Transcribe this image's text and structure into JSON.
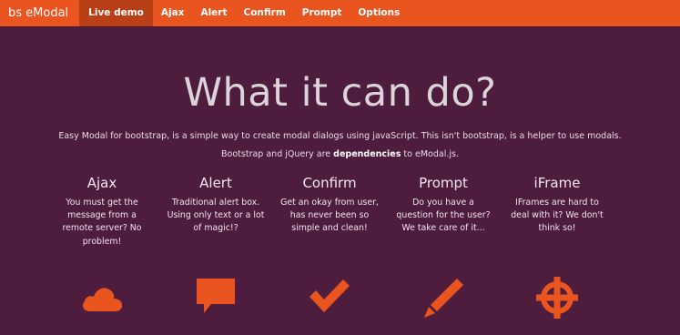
{
  "nav": {
    "brand": "bs eModal",
    "items": [
      "Live demo",
      "Ajax",
      "Alert",
      "Confirm",
      "Prompt",
      "Options"
    ]
  },
  "hero": {
    "title": "What it can do?",
    "lead1": "Easy Modal for bootstrap, is a simple way to create modal dialogs using javaScript. This isn't bootstrap, is a helper to use modals.",
    "lead2_prefix": "Bootstrap and jQuery are ",
    "lead2_bold": "dependencies",
    "lead2_suffix": " to eModal.js."
  },
  "features": [
    {
      "title": "Ajax",
      "desc": "You must get the message from a remote server? No problem!",
      "icon": "cloud-icon"
    },
    {
      "title": "Alert",
      "desc": "Traditional alert box. Using only text or a lot of magic!?",
      "icon": "speech-bubble-icon"
    },
    {
      "title": "Confirm",
      "desc": "Get an okay from user, has never been so simple and clean!",
      "icon": "checkmark-icon"
    },
    {
      "title": "Prompt",
      "desc": "Do you have a question for the user? We take care of it...",
      "icon": "pencil-icon"
    },
    {
      "title": "iFrame",
      "desc": "IFrames are hard to deal with it? We don't think so!",
      "icon": "crosshair-icon"
    }
  ],
  "colors": {
    "navbar": "#e9541f",
    "navbar_active": "#b93f17",
    "background": "#4e1c3d",
    "icon": "#e9541f"
  }
}
